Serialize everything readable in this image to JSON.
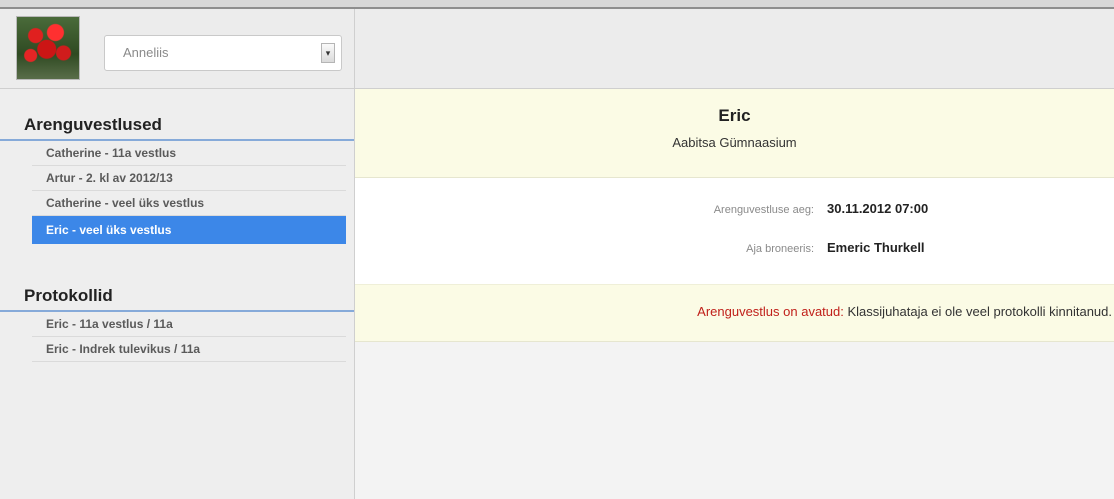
{
  "header": {
    "avatar_icon": "flower-photo",
    "user_select": {
      "value": "Anneliis",
      "arrow_symbol": "▾"
    }
  },
  "sidebar": {
    "sections": [
      {
        "title": "Arenguvestlused",
        "items": [
          {
            "label": "Catherine - 11a vestlus",
            "active": false
          },
          {
            "label": "Artur - 2. kl av 2012/13",
            "active": false
          },
          {
            "label": "Catherine - veel üks vestlus",
            "active": false
          },
          {
            "label": "Eric - veel üks vestlus",
            "active": true
          }
        ]
      },
      {
        "title": "Protokollid",
        "items": [
          {
            "label": "Eric - 11a vestlus / 11a",
            "active": false
          },
          {
            "label": "Eric - Indrek tulevikus / 11a",
            "active": false
          }
        ]
      }
    ]
  },
  "main": {
    "banner": {
      "name": "Eric",
      "school": "Aabitsa Gümnaasium"
    },
    "details": [
      {
        "label": "Arenguvestluse aeg:",
        "value": "30.11.2012 07:00"
      },
      {
        "label": "Aja broneeris:",
        "value": "Emeric Thurkell"
      }
    ],
    "status": {
      "label": "Arenguvestlus on avatud:",
      "message": "Klassijuhataja ei ole veel protokolli kinnitanud."
    }
  },
  "colors": {
    "active_item": "#3c87e8",
    "section_underline": "#86aad9",
    "banner_bg": "#fbfbe5",
    "status_label": "#c0201a"
  }
}
